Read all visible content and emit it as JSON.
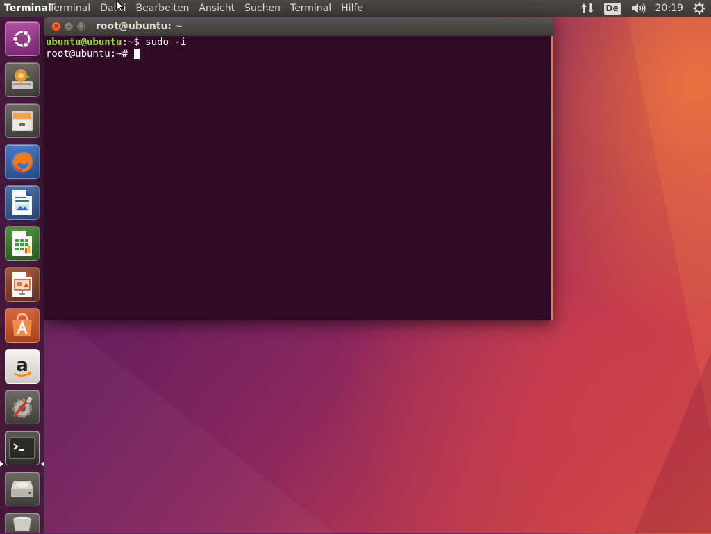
{
  "topbar": {
    "app_title": "Terminal",
    "menu": [
      "Terminal",
      "Datei",
      "Bearbeiten",
      "Ansicht",
      "Suchen",
      "Terminal",
      "Hilfe"
    ],
    "indicators": {
      "network_icon": "network-updown-icon",
      "keyboard_layout": "De",
      "sound_icon": "volume-icon",
      "clock": "20:19",
      "session_icon": "power-gear-icon"
    }
  },
  "launcher": {
    "items": [
      {
        "name": "dash-home",
        "icon": "ubuntu-logo-icon"
      },
      {
        "name": "install-ubuntu",
        "icon": "installer-icon"
      },
      {
        "name": "files",
        "icon": "file-cabinet-icon"
      },
      {
        "name": "firefox",
        "icon": "firefox-icon"
      },
      {
        "name": "libreoffice-writer",
        "icon": "writer-icon"
      },
      {
        "name": "libreoffice-calc",
        "icon": "calc-icon"
      },
      {
        "name": "libreoffice-impress",
        "icon": "impress-icon"
      },
      {
        "name": "ubuntu-software",
        "icon": "software-center-icon"
      },
      {
        "name": "amazon",
        "icon": "amazon-icon"
      },
      {
        "name": "system-settings",
        "icon": "settings-tools-icon"
      },
      {
        "name": "terminal",
        "icon": "terminal-icon",
        "running": true
      },
      {
        "name": "disk-drive",
        "icon": "hard-drive-icon"
      },
      {
        "name": "trash",
        "icon": "trash-icon"
      }
    ]
  },
  "window": {
    "title": "root@ubuntu: ~",
    "terminal": {
      "line1": {
        "user_host": "ubuntu@ubuntu",
        "path": ":~$",
        "command": " sudo -i"
      },
      "line2": {
        "prompt": "root@ubuntu:~# "
      }
    }
  },
  "colors": {
    "terminal_bg": "#300a24",
    "prompt_green": "#8ae234",
    "close_orange": "#df4a16",
    "panel_bg": "#3c3b37"
  }
}
